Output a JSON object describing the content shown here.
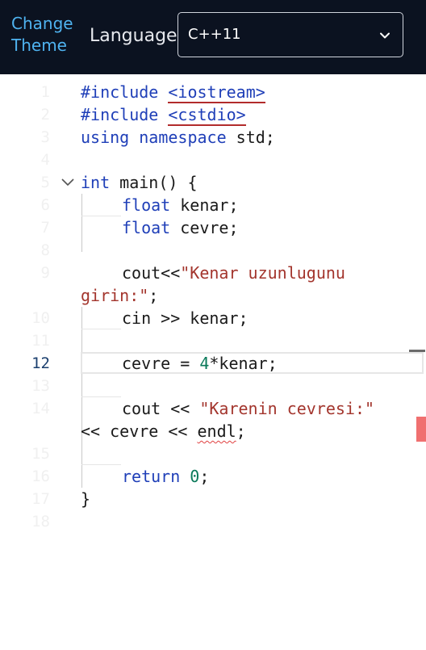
{
  "topbar": {
    "theme_link": "Change Theme",
    "language_label": "Language",
    "language_value": "C++11"
  },
  "editor": {
    "line_numbers": [
      "1",
      "2",
      "3",
      "4",
      "5",
      "6",
      "7",
      "8",
      "9",
      "10",
      "11",
      "12",
      "13",
      "14",
      "15",
      "16",
      "17",
      "18"
    ],
    "active_line_number": "12",
    "code": {
      "l1_a": "#include ",
      "l1_b": "<iostream>",
      "l2_a": "#include ",
      "l2_b": "<cstdio>",
      "l3_a": "using",
      "l3_b": "namespace",
      "l3_c": " std;",
      "l5_a": "int",
      "l5_b": " main() {",
      "l6_a": "float",
      "l6_b": " kenar;",
      "l7_a": "float",
      "l7_b": " cevre;",
      "l9_a": "cout<<",
      "l9_b": "\"Kenar uzunlugunu",
      "l9c_a": "girin:\"",
      "l9c_b": ";",
      "l10": "cin >> kenar;",
      "l12_a": "cevre = ",
      "l12_b": "4",
      "l12_c": "*kenar;",
      "l14_a": "cout << ",
      "l14_b": "\"Karenin cevresi:\"",
      "l14c_a": "<< cevre << ",
      "l14c_b": "endl",
      "l14c_c": ";",
      "l16_a": "return",
      "l16_b": " ",
      "l16_c": "0",
      "l16_d": ";",
      "l17": "}"
    }
  }
}
